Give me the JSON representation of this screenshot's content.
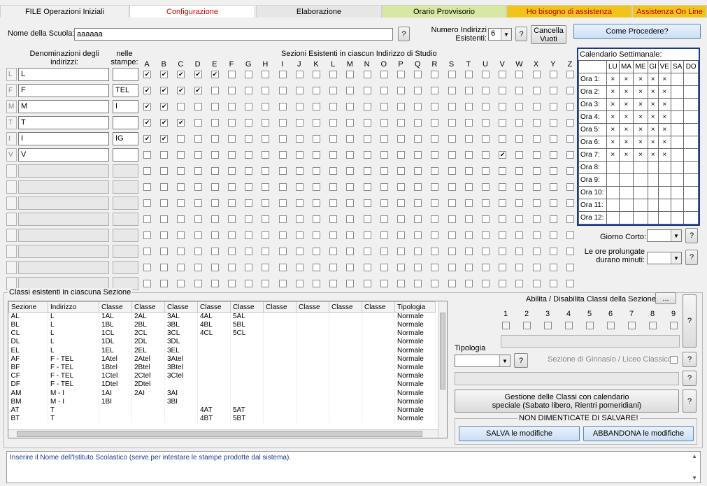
{
  "tabs": [
    {
      "label": "FILE Operazioni Iniziali",
      "bg": "#f0f0f0",
      "color": "#000"
    },
    {
      "label": "Configurazione",
      "bg": "#ffffff",
      "color": "#d00000"
    },
    {
      "label": "Elaborazione",
      "bg": "#e6e6e6",
      "color": "#000"
    },
    {
      "label": "Orario Provvisorio",
      "bg": "#d7e8a3",
      "color": "#000"
    },
    {
      "label": "Ho bisogno di assistenza",
      "bg": "#f0c419",
      "color": "#c00000"
    },
    {
      "label": "Assistenza On Line",
      "bg": "#f0c419",
      "color": "#c00000"
    }
  ],
  "school": {
    "label": "Nome della Scuola:",
    "value": "aaaaaa",
    "help": "?"
  },
  "indirizzi": {
    "label": "Numero Indirizzi Esistenti:",
    "value": "6",
    "help": "?",
    "clear_label": "Cancella Vuoti"
  },
  "come_procedere": "Come Procedere?",
  "headers": {
    "denominazioni": "Denominazioni degli indirizzi:",
    "stampe": "nelle stampe:",
    "sezioni": "Sezioni Esistenti in ciascun Indirizzo di Studio"
  },
  "letters": [
    "A",
    "B",
    "C",
    "D",
    "E",
    "F",
    "G",
    "H",
    "I",
    "J",
    "K",
    "L",
    "M",
    "N",
    "O",
    "P",
    "Q",
    "R",
    "S",
    "T",
    "U",
    "V",
    "W",
    "X",
    "Y",
    "Z"
  ],
  "rows": [
    {
      "code": "L",
      "name": "L",
      "stampa": "",
      "checked": [
        0,
        1,
        2,
        3,
        4
      ]
    },
    {
      "code": "F",
      "name": "F",
      "stampa": "TEL",
      "checked": [
        0,
        1,
        2,
        3
      ]
    },
    {
      "code": "M",
      "name": "M",
      "stampa": "I",
      "checked": [
        0,
        1
      ]
    },
    {
      "code": "T",
      "name": "T",
      "stampa": "",
      "checked": [
        0,
        1,
        2
      ]
    },
    {
      "code": "I",
      "name": "I",
      "stampa": "IG",
      "checked": [
        0,
        1
      ]
    },
    {
      "code": "V",
      "name": "V",
      "stampa": "",
      "checked": [
        21
      ]
    },
    {
      "code": "",
      "name": "",
      "stampa": "",
      "checked": []
    },
    {
      "code": "",
      "name": "",
      "stampa": "",
      "checked": []
    },
    {
      "code": "",
      "name": "",
      "stampa": "",
      "checked": []
    },
    {
      "code": "",
      "name": "",
      "stampa": "",
      "checked": []
    },
    {
      "code": "",
      "name": "",
      "stampa": "",
      "checked": []
    },
    {
      "code": "",
      "name": "",
      "stampa": "",
      "checked": []
    },
    {
      "code": "",
      "name": "",
      "stampa": "",
      "checked": []
    },
    {
      "code": "",
      "name": "",
      "stampa": "",
      "checked": []
    }
  ],
  "calendar": {
    "title": "Calendario Settimanale:",
    "days": [
      "LU",
      "MA",
      "ME",
      "GI",
      "VE",
      "SA",
      "DO"
    ],
    "hours": [
      "Ora 1:",
      "Ora 2:",
      "Ora 3:",
      "Ora 4:",
      "Ora 5:",
      "Ora 6:",
      "Ora 7:",
      "Ora 8:",
      "Ora 9:",
      "Ora 10:",
      "Ora 11:",
      "Ora 12:"
    ],
    "marked_hours": 7,
    "marked_days": 5,
    "mark": "×"
  },
  "giorno_corto": {
    "label": "Giorno Corto:",
    "help": "?"
  },
  "ore_prolungate": {
    "label": "Le ore prolungate durano minuti:",
    "help": "?"
  },
  "classi": {
    "group_label": "Classi esistenti in ciascuna Sezione",
    "columns": [
      "Sezione",
      "Indirizzo",
      "Classe",
      "Classe",
      "Classe",
      "Classe",
      "Classe",
      "Classe",
      "Classe",
      "Classe",
      "Classe",
      "Tipologia"
    ],
    "rows": [
      [
        "AL",
        "L",
        "1AL",
        "2AL",
        "3AL",
        "4AL",
        "5AL",
        "",
        "",
        "",
        "",
        "Normale"
      ],
      [
        "BL",
        "L",
        "1BL",
        "2BL",
        "3BL",
        "4BL",
        "5BL",
        "",
        "",
        "",
        "",
        "Normale"
      ],
      [
        "CL",
        "L",
        "1CL",
        "2CL",
        "3CL",
        "4CL",
        "5CL",
        "",
        "",
        "",
        "",
        "Normale"
      ],
      [
        "DL",
        "L",
        "1DL",
        "2DL",
        "3DL",
        "",
        "",
        "",
        "",
        "",
        "",
        "Normale"
      ],
      [
        "EL",
        "L",
        "1EL",
        "2EL",
        "3EL",
        "",
        "",
        "",
        "",
        "",
        "",
        "Normale"
      ],
      [
        "AF",
        "F - TEL",
        "1Atel",
        "2Atel",
        "3Atel",
        "",
        "",
        "",
        "",
        "",
        "",
        "Normale"
      ],
      [
        "BF",
        "F - TEL",
        "1Btel",
        "2Btel",
        "3Btel",
        "",
        "",
        "",
        "",
        "",
        "",
        "Normale"
      ],
      [
        "CF",
        "F - TEL",
        "1Ctel",
        "2Ctel",
        "3Ctel",
        "",
        "",
        "",
        "",
        "",
        "",
        "Normale"
      ],
      [
        "DF",
        "F - TEL",
        "1Dtel",
        "2Dtel",
        "",
        "",
        "",
        "",
        "",
        "",
        "",
        "Normale"
      ],
      [
        "AM",
        "M - I",
        "1AI",
        "2AI",
        "3AI",
        "",
        "",
        "",
        "",
        "",
        "",
        "Normale"
      ],
      [
        "BM",
        "M - I",
        "1BI",
        "",
        "3BI",
        "",
        "",
        "",
        "",
        "",
        "",
        "Normale"
      ],
      [
        "AT",
        "T",
        "",
        "",
        "",
        "4AT",
        "5AT",
        "",
        "",
        "",
        "",
        "Normale"
      ],
      [
        "BT",
        "T",
        "",
        "",
        "",
        "4BT",
        "5BT",
        "",
        "",
        "",
        "",
        "Normale"
      ]
    ]
  },
  "abilita": {
    "label": "Abilita / Disabilita Classi della Sezione:",
    "dots": "...",
    "numbers": [
      "1",
      "2",
      "3",
      "4",
      "5",
      "6",
      "7",
      "8",
      "9"
    ],
    "help": "?"
  },
  "tipologia": {
    "label": "Tipologia",
    "help": "?"
  },
  "ginnasio": {
    "label": "Sezione di Ginnasio / Liceo Classico",
    "help": "?"
  },
  "gestione": {
    "label": "Gestione delle Classi con calendario speciale (Sabato libero, Rientri pomeridiani)",
    "help": "?"
  },
  "save_group": {
    "label": "NON DIMENTICATE DI SALVARE!",
    "save": "SALVA le modifiche",
    "cancel": "ABBANDONA le modifiche"
  },
  "status": "Inserire il Nome dell'Istituto Scolastico (serve per intestare le stampe prodotte dal sistema)."
}
